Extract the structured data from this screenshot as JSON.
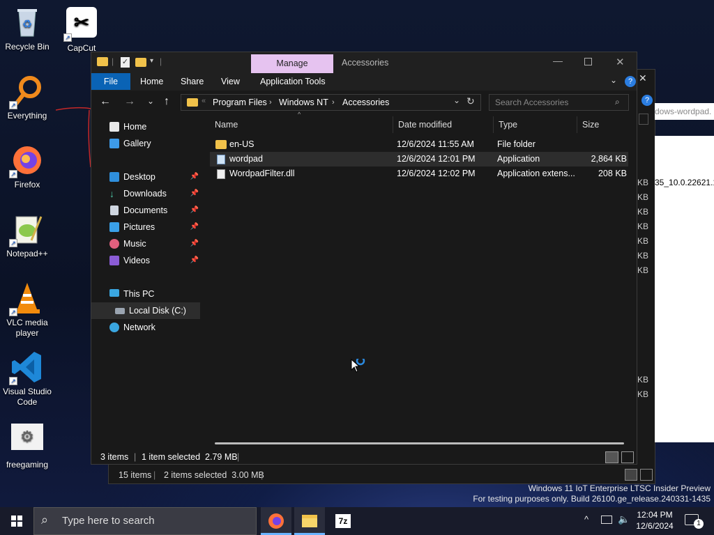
{
  "desktop": {
    "icons": [
      {
        "label": "Recycle Bin"
      },
      {
        "label": "CapCut"
      },
      {
        "label": "Everything"
      },
      {
        "label": "Firefox"
      },
      {
        "label": "Notepad++"
      },
      {
        "label": "VLC media player"
      },
      {
        "label": "Visual Studio Code"
      },
      {
        "label": "freegaming"
      }
    ],
    "watermark_line1": "Windows 11 IoT Enterprise LTSC Insider Preview",
    "watermark_line2": "For testing purposes only. Build 26100.ge_release.240331-1435"
  },
  "back_window": {
    "address_fragment": "dows-wordpad.",
    "file_fragment": "35_10.0.22621.1",
    "size_fragments": [
      "KB",
      "KB",
      "KB",
      "KB",
      "KB",
      "KB",
      "KB",
      "KB",
      "KB"
    ],
    "status_count": "15 items",
    "status_selected": "2 items selected  3.00 MB"
  },
  "window": {
    "title_context_tab": "Manage",
    "title_location": "Accessories",
    "ribbon_tabs": [
      "File",
      "Home",
      "Share",
      "View",
      "Application Tools"
    ],
    "breadcrumb": [
      "Program Files",
      "Windows NT",
      "Accessories"
    ],
    "search_placeholder": "Search Accessories",
    "nav": {
      "home": "Home",
      "gallery": "Gallery",
      "desktop": "Desktop",
      "downloads": "Downloads",
      "documents": "Documents",
      "pictures": "Pictures",
      "music": "Music",
      "videos": "Videos",
      "this_pc": "This PC",
      "local_disk": "Local Disk (C:)",
      "network": "Network"
    },
    "columns": [
      "Name",
      "Date modified",
      "Type",
      "Size"
    ],
    "files": [
      {
        "name": "en-US",
        "date": "12/6/2024 11:55 AM",
        "type": "File folder",
        "size": "",
        "selected": false
      },
      {
        "name": "wordpad",
        "date": "12/6/2024 12:01 PM",
        "type": "Application",
        "size": "2,864 KB",
        "selected": true
      },
      {
        "name": "WordpadFilter.dll",
        "date": "12/6/2024 12:02 PM",
        "type": "Application extens...",
        "size": "208 KB",
        "selected": false
      }
    ],
    "status_count": "3 items",
    "status_selected": "1 item selected  2.79 MB"
  },
  "taskbar": {
    "search_placeholder": "Type here to search",
    "apps": [
      "Firefox",
      "File Explorer",
      "7-Zip"
    ],
    "time": "12:04 PM",
    "date": "12/6/2024",
    "notification_count": "1"
  },
  "colors": {
    "accent": "#0a63b5",
    "context_tab": "#e6c3f0",
    "folder": "#f1c24a",
    "selection": "#2d2d2d"
  }
}
